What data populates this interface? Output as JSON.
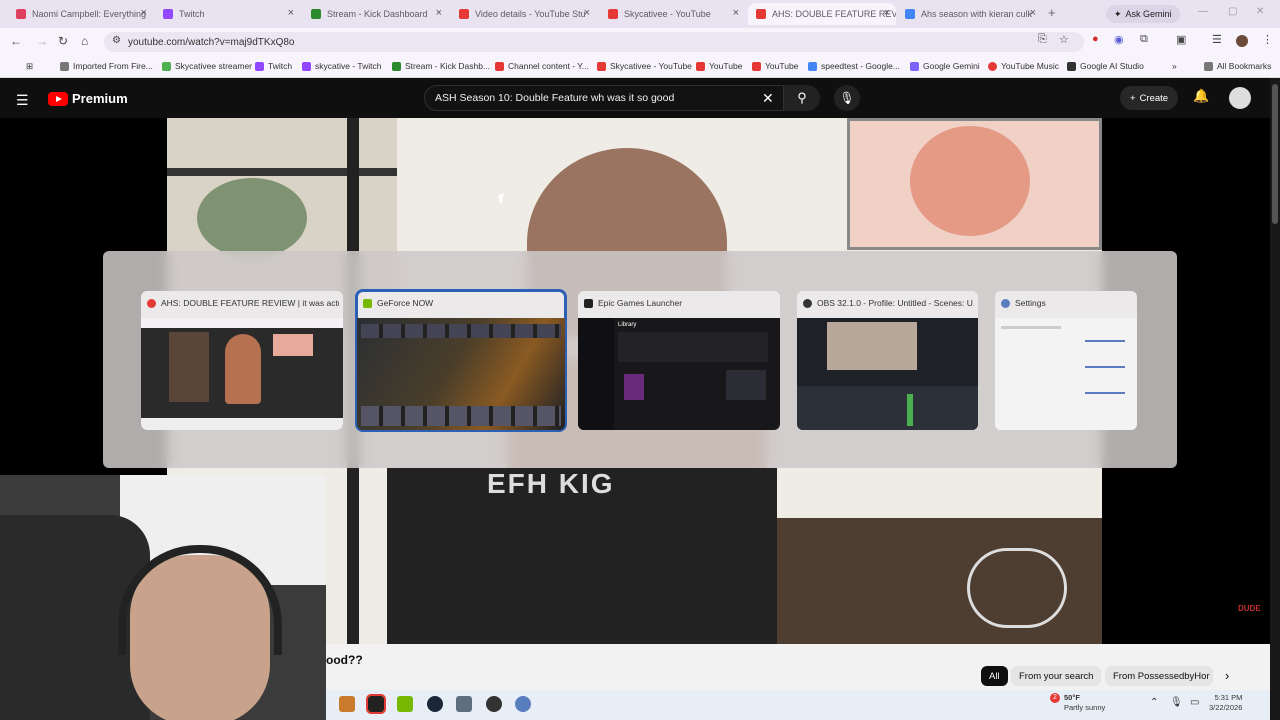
{
  "browser": {
    "tabs": [
      {
        "title": "Naomi Campbell: Everything",
        "color": "#e04060"
      },
      {
        "title": "Twitch",
        "color": "#9146ff"
      },
      {
        "title": "Stream - Kick Dashboard",
        "color": "#2b8a2b"
      },
      {
        "title": "Video details - YouTube Stu",
        "color": "#e53935"
      },
      {
        "title": "Skycativee - YouTube",
        "color": "#e53935"
      },
      {
        "title": "AHS: DOUBLE FEATURE REV",
        "color": "#e53935"
      },
      {
        "title": "Ahs season with kieran culk",
        "color": "#4285f4"
      }
    ],
    "new_tab": "+",
    "ask_gemini": "Ask Gemini",
    "url": "youtube.com/watch?v=maj9dTKxQ8o",
    "bookmarks": [
      {
        "label": "Imported From Fire...",
        "color": "#777"
      },
      {
        "label": "Skycativee streamer",
        "color": "#4caf50"
      },
      {
        "label": "Twitch",
        "color": "#9146ff"
      },
      {
        "label": "skycative - Twitch",
        "color": "#9146ff"
      },
      {
        "label": "Stream - Kick Dashb...",
        "color": "#2b8a2b"
      },
      {
        "label": "Channel content - Y...",
        "color": "#e53935"
      },
      {
        "label": "Skycativee - YouTube",
        "color": "#e53935"
      },
      {
        "label": "YouTube",
        "color": "#e53935"
      },
      {
        "label": "YouTube",
        "color": "#e53935"
      },
      {
        "label": "speedtest - Google...",
        "color": "#4285f4"
      },
      {
        "label": "Google Gemini",
        "color": "#7b61ff"
      },
      {
        "label": "YouTube Music",
        "color": "#e53935"
      },
      {
        "label": "Google AI Studio",
        "color": "#333"
      }
    ],
    "all_bookmarks": "All Bookmarks"
  },
  "youtube": {
    "logo_text": "Premium",
    "search_value": "ASH  Season 10: Double Feature wh was it so good",
    "create_label": "Create",
    "video_title_fragment": "ood??",
    "filter_chips": [
      "All",
      "From your search",
      "From PossessedbyHor"
    ],
    "shirt_text": "EFH KIG"
  },
  "switcher": {
    "windows": [
      {
        "title": "AHS: DOUBLE FEATURE REVIEW | it was actual...",
        "icon_color": "#e53935",
        "selected": false
      },
      {
        "title": "GeForce NOW",
        "icon_color": "#76b900",
        "selected": true
      },
      {
        "title": "Epic Games Launcher",
        "icon_color": "#222222",
        "selected": false
      },
      {
        "title": "OBS 32.1.0 - Profile: Untitled - Scenes: U...",
        "icon_color": "#333333",
        "selected": false
      },
      {
        "title": "Settings",
        "icon_color": "#5a7dbf",
        "selected": false
      }
    ],
    "epic_library_label": "Library"
  },
  "taskbar": {
    "weather_temp": "50°F",
    "weather_desc": "Partly sunny",
    "weather_badge": "2",
    "time": "5:31 PM",
    "date": "3/22/2026"
  },
  "watermark_text": "DUDE"
}
